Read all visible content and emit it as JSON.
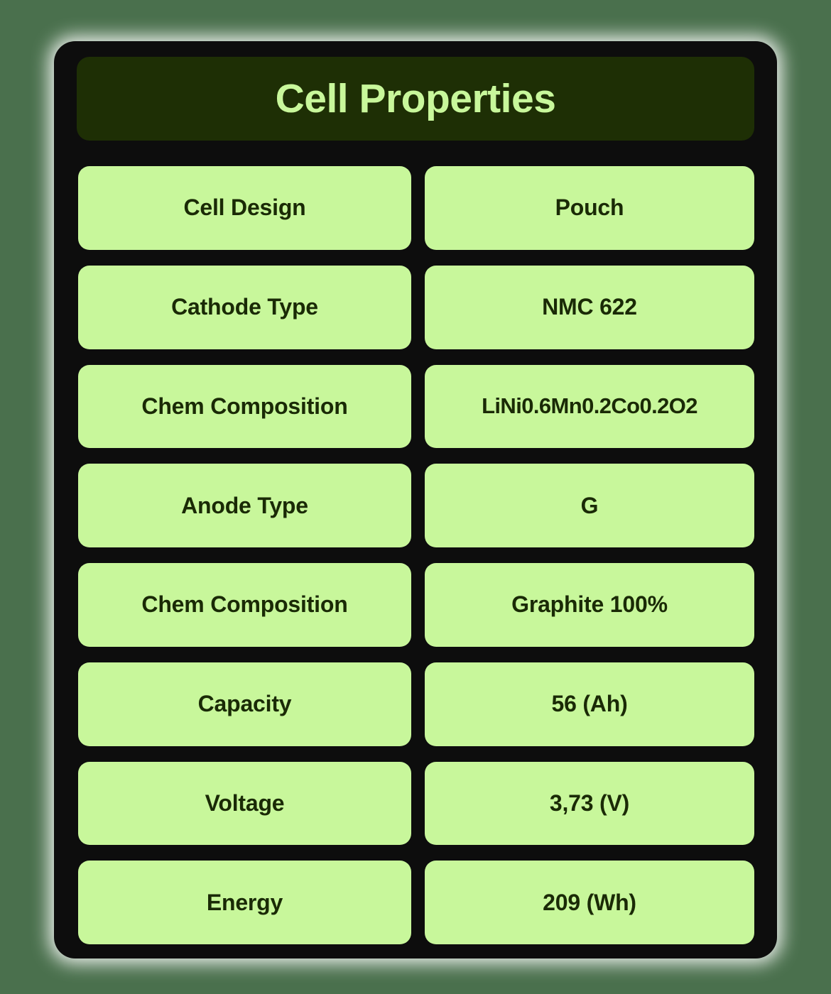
{
  "header": {
    "title": "Cell Properties"
  },
  "colors": {
    "page_background": "#4a704d",
    "card_background": "#0d0d0d",
    "header_background": "#1e2f05",
    "accent_green": "#c8f79b",
    "text_dark": "#1a2a06"
  },
  "table": {
    "rows": [
      {
        "label": "Cell Design",
        "value": "Pouch"
      },
      {
        "label": "Cathode Type",
        "value": "NMC 622"
      },
      {
        "label": "Chem Composition",
        "value": "LiNi0.6Mn0.2Co0.2O2"
      },
      {
        "label": "Anode Type",
        "value": "G"
      },
      {
        "label": "Chem Composition",
        "value": "Graphite 100%"
      },
      {
        "label": "Capacity",
        "value": "56 (Ah)"
      },
      {
        "label": "Voltage",
        "value": "3,73 (V)"
      },
      {
        "label": "Energy",
        "value": "209 (Wh)"
      }
    ]
  }
}
